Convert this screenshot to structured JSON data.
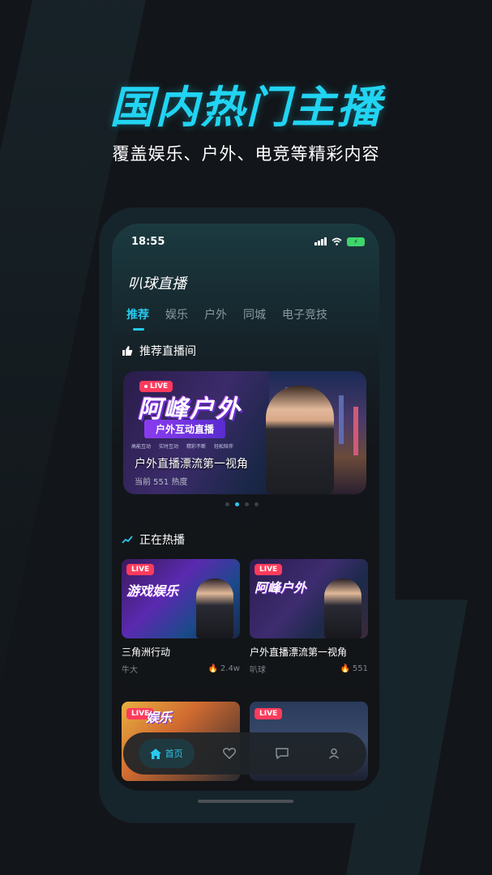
{
  "promo": {
    "headline": "国内热门主播",
    "subheadline": "覆盖娱乐、户外、电竞等精彩内容"
  },
  "status_bar": {
    "time": "18:55",
    "icons": [
      "signal-icon",
      "wifi-icon",
      "battery-charging-icon"
    ]
  },
  "app": {
    "title": "叭球直播"
  },
  "tabs": [
    {
      "label": "推荐",
      "active": true
    },
    {
      "label": "娱乐",
      "active": false
    },
    {
      "label": "户外",
      "active": false
    },
    {
      "label": "同城",
      "active": false
    },
    {
      "label": "电子竞技",
      "active": false
    }
  ],
  "recommended": {
    "heading": "推荐直播间",
    "icon": "thumbs-up-icon",
    "banner": {
      "badge": "LIVE",
      "brand": "阿峰户外",
      "strap": "户外互动直播",
      "features": [
        "高能互动",
        "实时互动",
        "精彩不断",
        "轻松陪伴"
      ],
      "caption": "户外直播漂流第一视角",
      "heat": "当前 551 热度"
    },
    "carousel": {
      "count": 4,
      "active_index": 1
    }
  },
  "hot": {
    "heading": "正在热播",
    "icon": "trending-icon",
    "cards": [
      {
        "title": "三角洲行动",
        "host": "牛大",
        "heat": "2.4w",
        "badge": "LIVE",
        "thumb_text": "游戏娱乐",
        "thumb": "game"
      },
      {
        "title": "户外直播漂流第一视角",
        "host": "叭球",
        "heat": "551",
        "badge": "LIVE",
        "thumb_text": "阿峰户外",
        "thumb": "outdoor"
      },
      {
        "title": "",
        "host": "",
        "heat": "",
        "badge": "LIVE",
        "thumb_text": "娱乐",
        "thumb": "comic"
      },
      {
        "title": "",
        "host": "",
        "heat": "",
        "badge": "LIVE",
        "thumb_text": "",
        "thumb": "fantasy"
      }
    ]
  },
  "bottom_nav": {
    "items": [
      {
        "label": "首页",
        "icon": "home-icon",
        "active": true
      },
      {
        "label": "",
        "icon": "heart-icon",
        "active": false
      },
      {
        "label": "",
        "icon": "message-icon",
        "active": false
      },
      {
        "label": "",
        "icon": "user-icon",
        "active": false
      }
    ]
  },
  "colors": {
    "accent": "#29c9ee",
    "live": "#ff3b5c",
    "background": "#121519"
  }
}
